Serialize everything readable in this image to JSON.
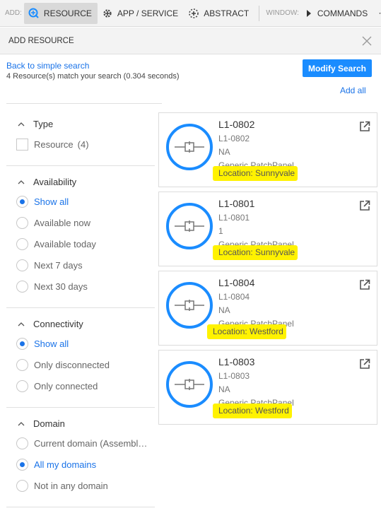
{
  "toolbar": {
    "add_label": "ADD:",
    "resource": "RESOURCE",
    "app_service": "APP / SERVICE",
    "abstract": "ABSTRACT",
    "window_label": "WINDOW:",
    "commands": "COMMANDS"
  },
  "panel": {
    "title": "ADD RESOURCE",
    "back_link": "Back to simple search",
    "match_text": "4 Resource(s) match your search (0.304 seconds)",
    "modify_button": "Modify Search",
    "add_all": "Add all"
  },
  "filters": {
    "type": {
      "title": "Type",
      "options": [
        {
          "label": "Resource",
          "count": "(4)",
          "checked": false
        }
      ]
    },
    "availability": {
      "title": "Availability",
      "options": [
        "Show all",
        "Available now",
        "Available today",
        "Next 7 days",
        "Next 30 days"
      ],
      "selected": "Show all"
    },
    "connectivity": {
      "title": "Connectivity",
      "options": [
        "Show all",
        "Only disconnected",
        "Only connected"
      ],
      "selected": "Show all"
    },
    "domain": {
      "title": "Domain",
      "options": [
        "Current domain (Assembl…",
        "All my domains",
        "Not in any domain"
      ],
      "selected": "All my domains"
    }
  },
  "results": [
    {
      "name": "L1-0802",
      "id": "L1-0802",
      "detail": "NA",
      "model": "Generic PatchPanel",
      "location": "Location: Sunnyvale"
    },
    {
      "name": "L1-0801",
      "id": "L1-0801",
      "detail": "1",
      "model": "Generic PatchPanel",
      "location": "Location: Sunnyvale"
    },
    {
      "name": "L1-0804",
      "id": "L1-0804",
      "detail": "NA",
      "model": "Generic PatchPanel",
      "location": "Location: Westford"
    },
    {
      "name": "L1-0803",
      "id": "L1-0803",
      "detail": "NA",
      "model": "Generic PatchPanel",
      "location": "Location: Westford"
    }
  ],
  "colors": {
    "accent": "#1a8cff",
    "link": "#1a73e8",
    "highlight": "#fff200"
  },
  "icons": [
    "resource-add-icon",
    "app-service-icon",
    "abstract-icon",
    "commands-icon",
    "close-icon",
    "chevron-up-icon",
    "patch-panel-icon",
    "open-external-icon"
  ]
}
